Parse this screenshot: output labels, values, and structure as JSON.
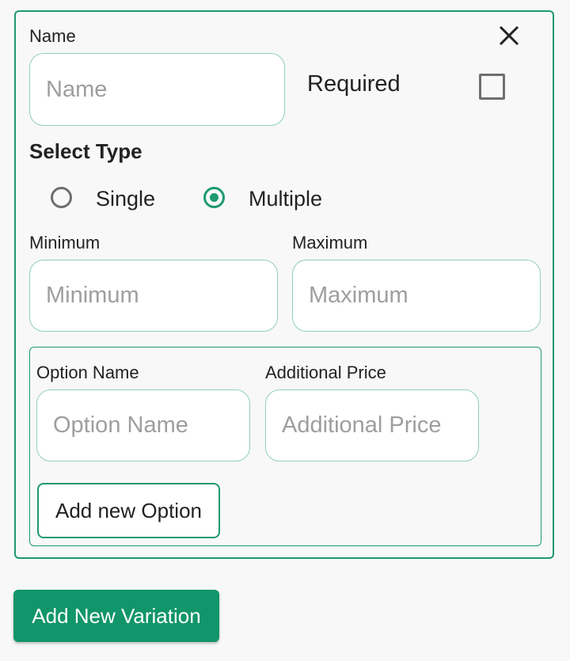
{
  "colors": {
    "accent": "#1e9a6e",
    "button_bg": "#11956a"
  },
  "variation": {
    "name_label": "Name",
    "name_placeholder": "Name",
    "required_label": "Required",
    "required_checked": false,
    "select_type_label": "Select Type",
    "type_options": [
      {
        "label": "Single",
        "selected": false
      },
      {
        "label": "Multiple",
        "selected": true
      }
    ],
    "minimum_label": "Minimum",
    "minimum_placeholder": "Minimum",
    "maximum_label": "Maximum",
    "maximum_placeholder": "Maximum",
    "options": {
      "option_name_label": "Option Name",
      "option_name_placeholder": "Option Name",
      "additional_price_label": "Additional Price",
      "additional_price_placeholder": "Additional Price",
      "add_option_button": "Add new Option"
    }
  },
  "add_variation_button": "Add New Variation"
}
